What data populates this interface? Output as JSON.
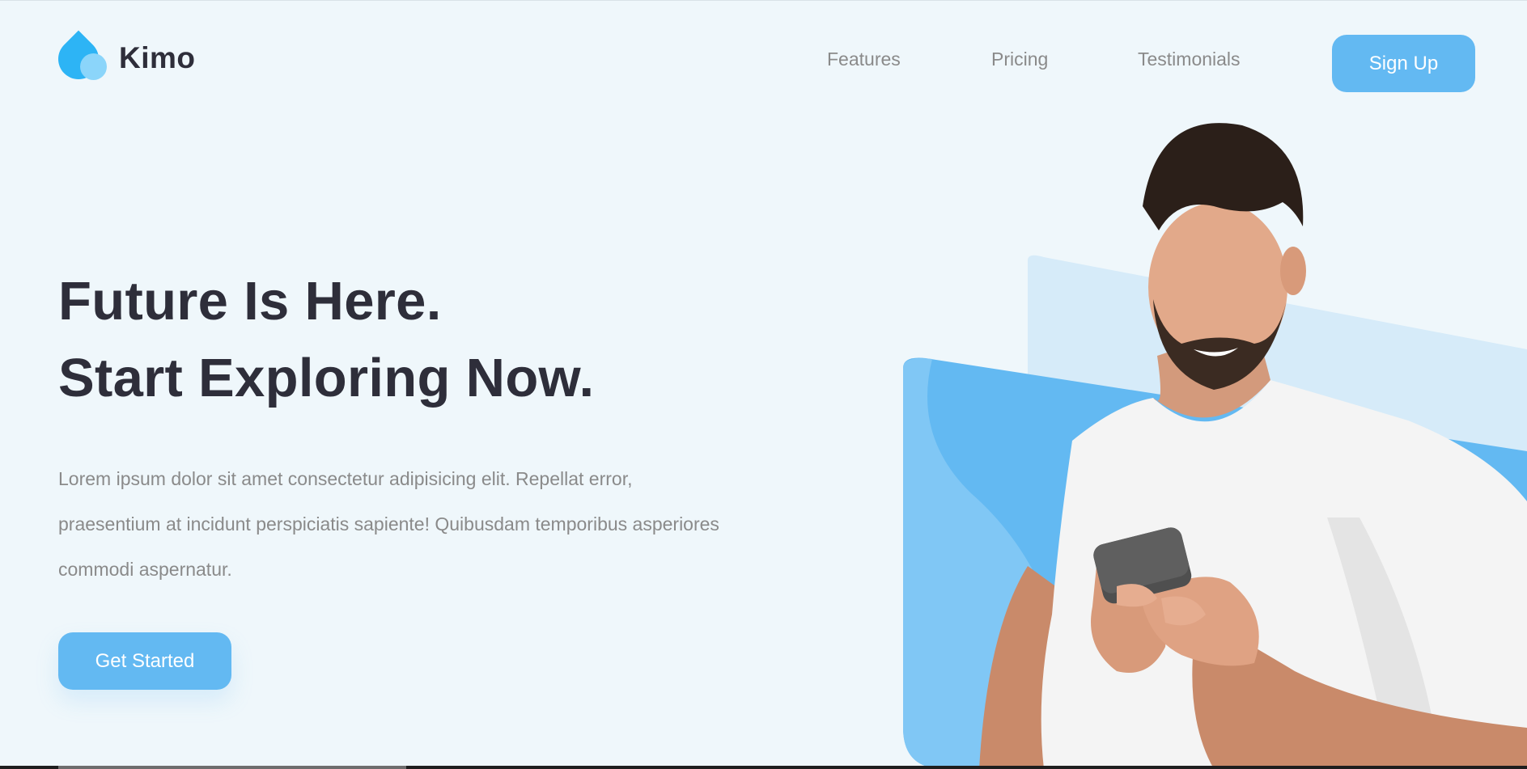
{
  "brand": {
    "name": "Kimo",
    "logo_icon": "water-drops-icon"
  },
  "nav": {
    "links": [
      "Features",
      "Pricing",
      "Testimonials"
    ],
    "signup_label": "Sign Up"
  },
  "hero": {
    "title_lines": [
      "Future Is Here.",
      "Start Exploring Now."
    ],
    "description_lines": [
      "Lorem ipsum dolor sit amet consectetur adipisicing elit. Repellat error,",
      "praesentium at incidunt perspiciatis sapiente! Quibusdam temporibus asperiores",
      "commodi aspernatur."
    ],
    "cta_label": "Get Started",
    "image": "man-smiling-at-smartphone-photo"
  },
  "colors": {
    "background": "#eff7fb",
    "accent": "#63b9f2",
    "heading": "#2e2e3a",
    "body_text": "#8a8a8a",
    "logo_primary": "#2db4f5",
    "logo_secondary": "#8bd5fa",
    "shape_light": "#d6ebf9",
    "shape_mid": "#63b9f2"
  }
}
